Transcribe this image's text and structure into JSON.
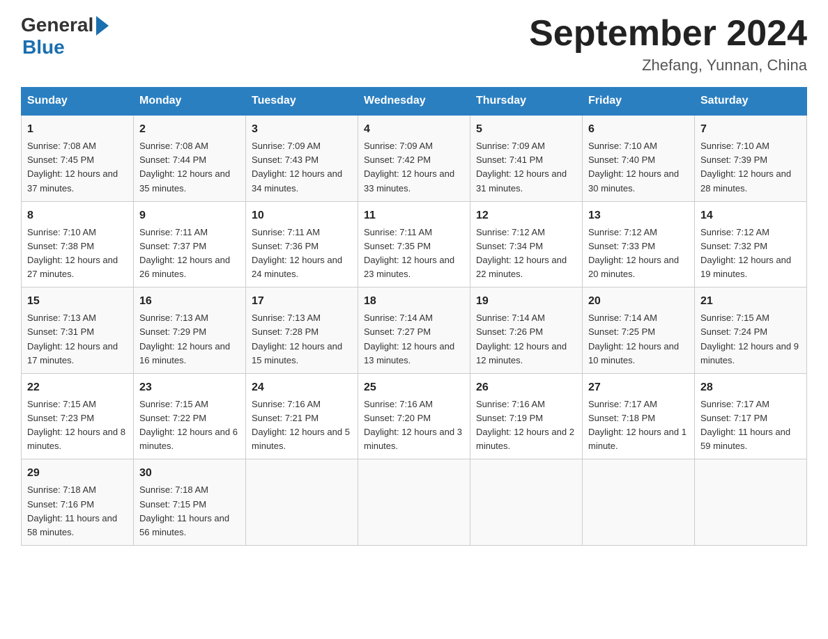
{
  "header": {
    "logo_general": "General",
    "logo_blue": "Blue",
    "title": "September 2024",
    "subtitle": "Zhefang, Yunnan, China"
  },
  "calendar": {
    "days_of_week": [
      "Sunday",
      "Monday",
      "Tuesday",
      "Wednesday",
      "Thursday",
      "Friday",
      "Saturday"
    ],
    "weeks": [
      [
        {
          "day": "1",
          "sunrise": "7:08 AM",
          "sunset": "7:45 PM",
          "daylight": "12 hours and 37 minutes."
        },
        {
          "day": "2",
          "sunrise": "7:08 AM",
          "sunset": "7:44 PM",
          "daylight": "12 hours and 35 minutes."
        },
        {
          "day": "3",
          "sunrise": "7:09 AM",
          "sunset": "7:43 PM",
          "daylight": "12 hours and 34 minutes."
        },
        {
          "day": "4",
          "sunrise": "7:09 AM",
          "sunset": "7:42 PM",
          "daylight": "12 hours and 33 minutes."
        },
        {
          "day": "5",
          "sunrise": "7:09 AM",
          "sunset": "7:41 PM",
          "daylight": "12 hours and 31 minutes."
        },
        {
          "day": "6",
          "sunrise": "7:10 AM",
          "sunset": "7:40 PM",
          "daylight": "12 hours and 30 minutes."
        },
        {
          "day": "7",
          "sunrise": "7:10 AM",
          "sunset": "7:39 PM",
          "daylight": "12 hours and 28 minutes."
        }
      ],
      [
        {
          "day": "8",
          "sunrise": "7:10 AM",
          "sunset": "7:38 PM",
          "daylight": "12 hours and 27 minutes."
        },
        {
          "day": "9",
          "sunrise": "7:11 AM",
          "sunset": "7:37 PM",
          "daylight": "12 hours and 26 minutes."
        },
        {
          "day": "10",
          "sunrise": "7:11 AM",
          "sunset": "7:36 PM",
          "daylight": "12 hours and 24 minutes."
        },
        {
          "day": "11",
          "sunrise": "7:11 AM",
          "sunset": "7:35 PM",
          "daylight": "12 hours and 23 minutes."
        },
        {
          "day": "12",
          "sunrise": "7:12 AM",
          "sunset": "7:34 PM",
          "daylight": "12 hours and 22 minutes."
        },
        {
          "day": "13",
          "sunrise": "7:12 AM",
          "sunset": "7:33 PM",
          "daylight": "12 hours and 20 minutes."
        },
        {
          "day": "14",
          "sunrise": "7:12 AM",
          "sunset": "7:32 PM",
          "daylight": "12 hours and 19 minutes."
        }
      ],
      [
        {
          "day": "15",
          "sunrise": "7:13 AM",
          "sunset": "7:31 PM",
          "daylight": "12 hours and 17 minutes."
        },
        {
          "day": "16",
          "sunrise": "7:13 AM",
          "sunset": "7:29 PM",
          "daylight": "12 hours and 16 minutes."
        },
        {
          "day": "17",
          "sunrise": "7:13 AM",
          "sunset": "7:28 PM",
          "daylight": "12 hours and 15 minutes."
        },
        {
          "day": "18",
          "sunrise": "7:14 AM",
          "sunset": "7:27 PM",
          "daylight": "12 hours and 13 minutes."
        },
        {
          "day": "19",
          "sunrise": "7:14 AM",
          "sunset": "7:26 PM",
          "daylight": "12 hours and 12 minutes."
        },
        {
          "day": "20",
          "sunrise": "7:14 AM",
          "sunset": "7:25 PM",
          "daylight": "12 hours and 10 minutes."
        },
        {
          "day": "21",
          "sunrise": "7:15 AM",
          "sunset": "7:24 PM",
          "daylight": "12 hours and 9 minutes."
        }
      ],
      [
        {
          "day": "22",
          "sunrise": "7:15 AM",
          "sunset": "7:23 PM",
          "daylight": "12 hours and 8 minutes."
        },
        {
          "day": "23",
          "sunrise": "7:15 AM",
          "sunset": "7:22 PM",
          "daylight": "12 hours and 6 minutes."
        },
        {
          "day": "24",
          "sunrise": "7:16 AM",
          "sunset": "7:21 PM",
          "daylight": "12 hours and 5 minutes."
        },
        {
          "day": "25",
          "sunrise": "7:16 AM",
          "sunset": "7:20 PM",
          "daylight": "12 hours and 3 minutes."
        },
        {
          "day": "26",
          "sunrise": "7:16 AM",
          "sunset": "7:19 PM",
          "daylight": "12 hours and 2 minutes."
        },
        {
          "day": "27",
          "sunrise": "7:17 AM",
          "sunset": "7:18 PM",
          "daylight": "12 hours and 1 minute."
        },
        {
          "day": "28",
          "sunrise": "7:17 AM",
          "sunset": "7:17 PM",
          "daylight": "11 hours and 59 minutes."
        }
      ],
      [
        {
          "day": "29",
          "sunrise": "7:18 AM",
          "sunset": "7:16 PM",
          "daylight": "11 hours and 58 minutes."
        },
        {
          "day": "30",
          "sunrise": "7:18 AM",
          "sunset": "7:15 PM",
          "daylight": "11 hours and 56 minutes."
        },
        null,
        null,
        null,
        null,
        null
      ]
    ]
  }
}
